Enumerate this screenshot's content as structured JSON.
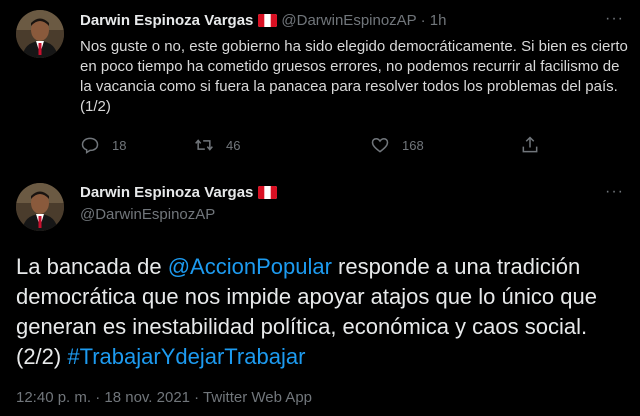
{
  "tweet1": {
    "author_name": "Darwin Espinoza Vargas",
    "handle": "@DarwinEspinozAP",
    "separator": "·",
    "time_ago": "1h",
    "more_label": "···",
    "text": "Nos guste o no, este gobierno ha sido elegido democráticamente. Si bien es cierto en poco tiempo ha cometido gruesos errores, no podemos recurrir al facilismo de la vacancia como si fuera la panacea para resolver todos los problemas del país. (1/2)",
    "replies": "18",
    "retweets": "46",
    "likes": "168"
  },
  "tweet2": {
    "author_name": "Darwin Espinoza Vargas",
    "handle": "@DarwinEspinozAP",
    "more_label": "···",
    "text_part1": "La bancada de ",
    "mention": "@AccionPopular",
    "text_part2": " responde a una tradición democrática que nos impide apoyar atajos que lo único que generan es inestabilidad política, económica y caos social. (2/2) ",
    "hashtag": "#TrabajarYdejarTrabajar",
    "meta": "12:40 p. m. · 18 nov. 2021 · Twitter Web App"
  },
  "icons": {
    "reply": "reply-icon",
    "retweet": "retweet-icon",
    "like": "heart-icon",
    "share": "share-icon",
    "flag": "peru-flag-icon"
  },
  "colors": {
    "background": "#000000",
    "link": "#1d9bf0",
    "secondary_text": "#71767b",
    "primary_text": "#e7e9ea",
    "flag_red": "#d91023"
  }
}
